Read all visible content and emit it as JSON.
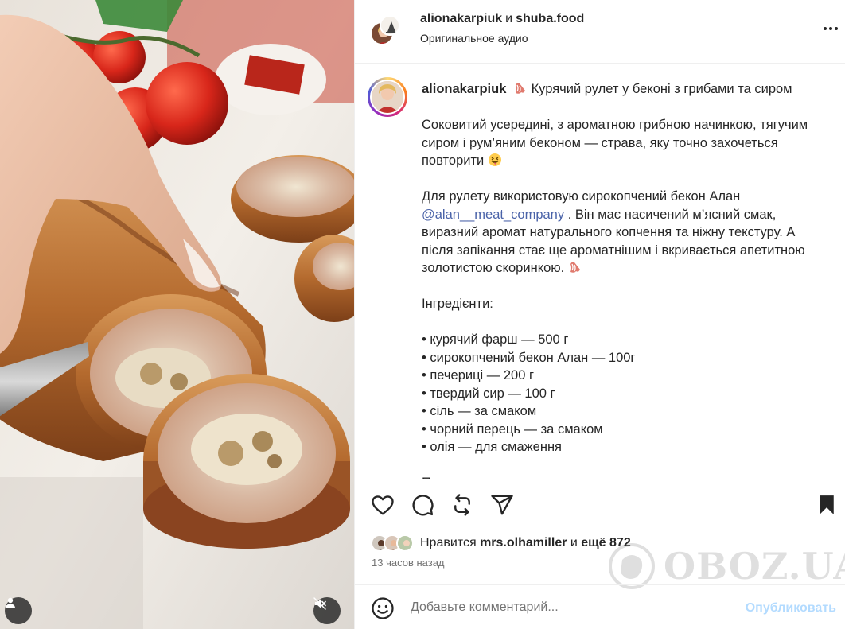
{
  "post": {
    "author": "alionakarpiuk",
    "and_word": "и",
    "coauthor": "shuba.food",
    "audio": "Оригинальное аудио"
  },
  "caption": {
    "username": "alionakarpiuk",
    "title": "Курячий рулет у беконі з грибами та сиром",
    "para1": "Соковитий усередині, з ароматною грибною начинкою, тягучим сиром і рум’яним беконом — страва, яку точно захочеться повторити",
    "para2_start": "Для рулету використовую сирокопчений бекон Алан",
    "mention": "@alan__meat_company",
    "para2_end": ". Він має насичений м’ясний смак, виразний аромат натурального копчення та ніжну текстуру. А після запікання стає ще ароматнішим і вкривається апетитною золотистою скоринкою.",
    "ingredients_title": "Інгредієнти:",
    "ingredients": [
      "• курячий фарш — 500 г",
      "• сирокопчений бекон Алан — 100г",
      "• печериці — 200 г",
      "• твердий сир — 100 г",
      "• сіль — за смаком",
      "• чорний перець — за смаком",
      "• олія — для смаження"
    ],
    "cut_line": "П"
  },
  "likes": {
    "prefix": "Нравится",
    "user": "mrs.olhamiller",
    "middle": "и",
    "count": "ещё 872"
  },
  "time_ago": "13 часов назад",
  "comment": {
    "placeholder": "Добавьте комментарий...",
    "publish": "Опубликовать"
  },
  "watermark": "OBOZ.UA",
  "icons": {
    "like": "heart-icon",
    "comment": "comment-icon",
    "repost": "repost-icon",
    "share": "share-icon",
    "save": "bookmark-icon",
    "emoji": "smiley-icon",
    "more": "more-icon",
    "mute": "muted-speaker-icon",
    "tagged": "user-icon"
  },
  "colors": {
    "mention": "#4962a8",
    "publish_disabled": "#b3dbff",
    "text": "#262626",
    "secondary": "#737373"
  }
}
